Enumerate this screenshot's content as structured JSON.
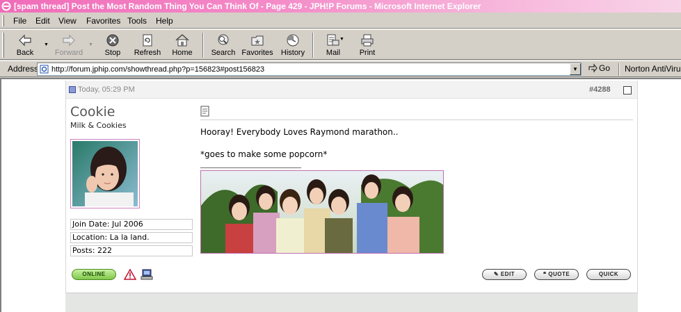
{
  "window": {
    "title": "[spam thread] Post the Most Random Thing You Can Think Of - Page 429 - JPH!P Forums - Microsoft Internet Explorer"
  },
  "menu": {
    "items": [
      "File",
      "Edit",
      "View",
      "Favorites",
      "Tools",
      "Help"
    ]
  },
  "toolbar": {
    "back": "Back",
    "forward": "Forward",
    "stop": "Stop",
    "refresh": "Refresh",
    "home": "Home",
    "search": "Search",
    "favorites": "Favorites",
    "history": "History",
    "mail": "Mail",
    "print": "Print"
  },
  "address": {
    "label": "Address",
    "url": "http://forum.jphip.com/showthread.php?p=156823#post156823",
    "go": "Go",
    "norton": "Norton AntiVirus"
  },
  "post": {
    "date": "Today, 05:29 PM",
    "number": "#4288",
    "username": "Cookie",
    "user_title": "Milk & Cookies",
    "join_date": "Join Date: Jul 2006",
    "location": "Location: La la land.",
    "posts": "Posts: 222",
    "message_line1": "Hooray! Everybody Loves Raymond marathon..",
    "message_line2": "*goes to make some popcorn*",
    "online_label": "ONLINE",
    "edit_label": "EDIT",
    "quote_label": "QUOTE",
    "quick_label": "QUICK"
  },
  "colors": {
    "titlebar_start": "#f06cb8",
    "avatar_border": "#d080c0",
    "online_green": "#7fc84a"
  }
}
